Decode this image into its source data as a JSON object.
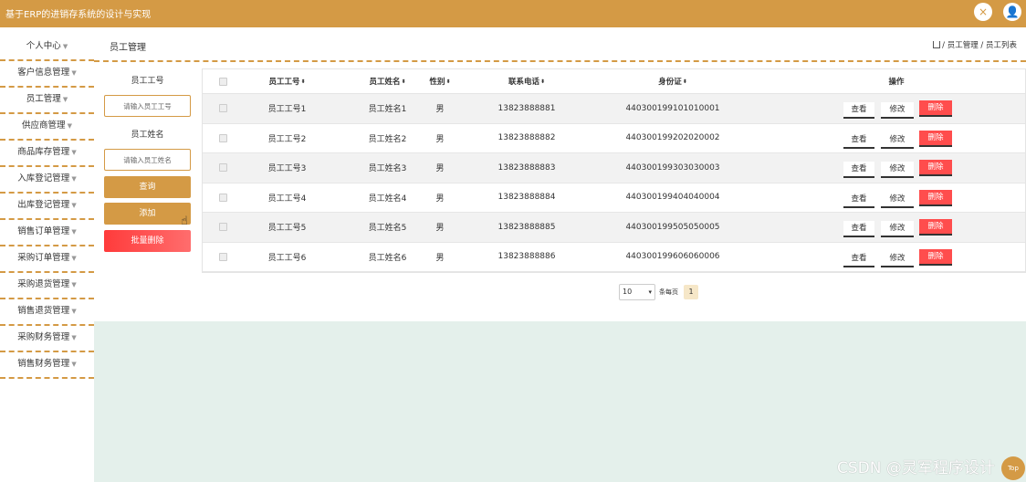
{
  "app": {
    "title": "基于ERP的进销存系统的设计与实现",
    "icons": {
      "fullscreen": "×",
      "user": "👤"
    }
  },
  "sidebar": {
    "items": [
      {
        "label": "个人中心"
      },
      {
        "label": "客户信息管理"
      },
      {
        "label": "员工管理"
      },
      {
        "label": "供应商管理"
      },
      {
        "label": "商品库存管理"
      },
      {
        "label": "入库登记管理"
      },
      {
        "label": "出库登记管理"
      },
      {
        "label": "销售订单管理"
      },
      {
        "label": "采购订单管理"
      },
      {
        "label": "采购退货管理"
      },
      {
        "label": "销售退货管理"
      },
      {
        "label": "采购财务管理"
      },
      {
        "label": "销售财务管理"
      }
    ]
  },
  "header": {
    "page_title": "员工管理",
    "breadcrumb": "/ 员工管理 / 员工列表"
  },
  "filter": {
    "emp_no_label": "员工工号",
    "emp_no_placeholder": "请输入员工工号",
    "emp_name_label": "员工姓名",
    "emp_name_placeholder": "请输入员工姓名",
    "search_label": "查询",
    "add_label": "添加",
    "batch_delete_label": "批量删除"
  },
  "table": {
    "columns": [
      "员工工号",
      "员工姓名",
      "性别",
      "联系电话",
      "身份证",
      "操作"
    ],
    "rows": [
      {
        "no": "员工工号1",
        "name": "员工姓名1",
        "gender": "男",
        "phone": "13823888881",
        "id": "440300199101010001"
      },
      {
        "no": "员工工号2",
        "name": "员工姓名2",
        "gender": "男",
        "phone": "13823888882",
        "id": "440300199202020002"
      },
      {
        "no": "员工工号3",
        "name": "员工姓名3",
        "gender": "男",
        "phone": "13823888883",
        "id": "440300199303030003"
      },
      {
        "no": "员工工号4",
        "name": "员工姓名4",
        "gender": "男",
        "phone": "13823888884",
        "id": "440300199404040004"
      },
      {
        "no": "员工工号5",
        "name": "员工姓名5",
        "gender": "男",
        "phone": "13823888885",
        "id": "440300199505050005"
      },
      {
        "no": "员工工号6",
        "name": "员工姓名6",
        "gender": "男",
        "phone": "13823888886",
        "id": "440300199606060006"
      }
    ],
    "actions": {
      "view": "查看",
      "edit": "修改",
      "delete": "删除"
    }
  },
  "pagination": {
    "page_size": "10",
    "per_page_label": "条每页",
    "current_page": "1"
  },
  "watermark": "CSDN @灵军程序设计",
  "back_to_top": "Top",
  "colors": {
    "accent": "#d49a45",
    "danger": "#ff4d4d",
    "panel_bg": "#e4f0eb"
  }
}
